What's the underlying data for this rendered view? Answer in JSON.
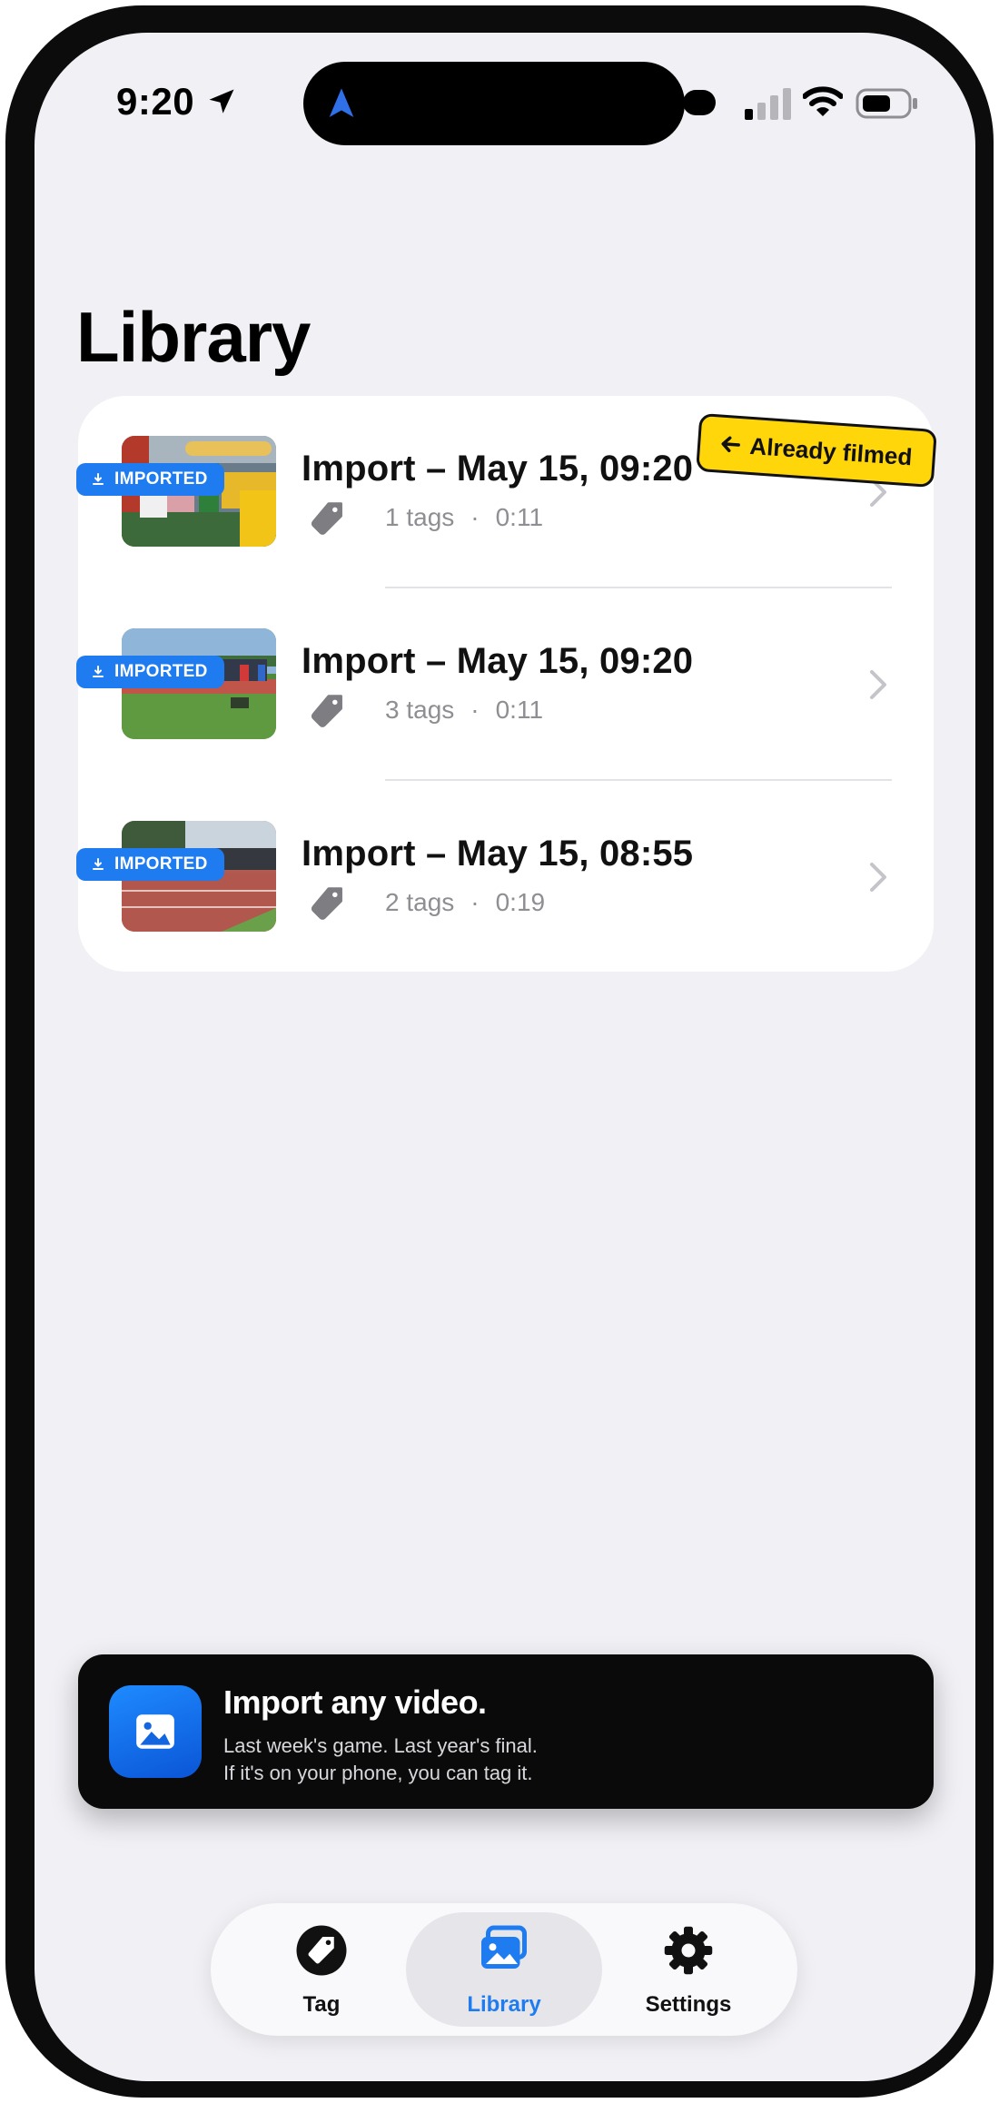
{
  "status_bar": {
    "time": "9:20"
  },
  "page": {
    "title": "Library"
  },
  "sticker": {
    "label": "Already filmed"
  },
  "library": {
    "items": [
      {
        "badge": "IMPORTED",
        "title": "Import – May 15, 09:20",
        "tags": "1 tags",
        "duration": "0:11"
      },
      {
        "badge": "IMPORTED",
        "title": "Import – May 15, 09:20",
        "tags": "3 tags",
        "duration": "0:11"
      },
      {
        "badge": "IMPORTED",
        "title": "Import – May 15, 08:55",
        "tags": "2 tags",
        "duration": "0:19"
      }
    ],
    "meta_separator": "·"
  },
  "promo": {
    "title": "Import any video.",
    "line1": "Last week's game. Last year's final.",
    "line2": "If it's on your phone, you can tag it."
  },
  "tabbar": {
    "selected": "Library",
    "tabs": [
      {
        "label": "Tag",
        "icon": "tag-icon"
      },
      {
        "label": "Library",
        "icon": "photos-icon"
      },
      {
        "label": "Settings",
        "icon": "gear-icon"
      }
    ]
  },
  "colors": {
    "accent": "#1e7cf0",
    "sticker": "#ffd60a",
    "background": "#f0f0f5",
    "promo_bg": "#0a0a0a"
  }
}
